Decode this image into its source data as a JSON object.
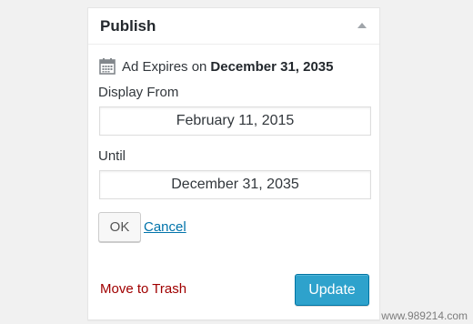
{
  "panel": {
    "title": "Publish"
  },
  "expiry": {
    "prefix": "Ad Expires on",
    "date": "December 31, 2035"
  },
  "display_from": {
    "label": "Display From",
    "value": "February 11, 2015"
  },
  "until": {
    "label": "Until",
    "value": "December 31, 2035"
  },
  "actions": {
    "ok_label": "OK",
    "cancel_label": "Cancel",
    "trash_label": "Move to Trash",
    "update_label": "Update"
  },
  "watermark": "www.989214.com",
  "icons": {
    "calendar": "calendar-icon",
    "toggle": "collapse-arrow-icon"
  },
  "colors": {
    "update_button": "#2ea2cc",
    "cancel_link": "#0073aa",
    "trash_link": "#a00000"
  }
}
